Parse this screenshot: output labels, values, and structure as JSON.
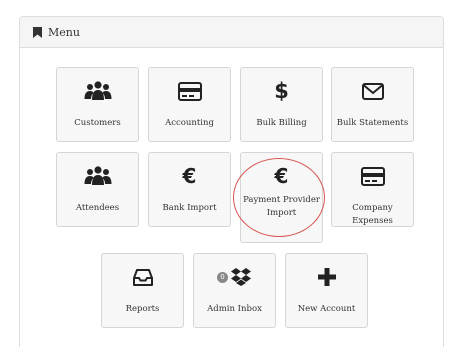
{
  "panel": {
    "title": "Menu",
    "icon": "bookmark-icon"
  },
  "tiles": [
    {
      "label": "Customers",
      "icon": "users-icon"
    },
    {
      "label": "Accounting",
      "icon": "credit-card-icon"
    },
    {
      "label": "Bulk Billing",
      "icon": "dollar-icon",
      "glyph": "$"
    },
    {
      "label": "Bulk Statements",
      "icon": "envelope-icon"
    },
    {
      "label": "Attendees",
      "icon": "users-icon"
    },
    {
      "label": "Bank Import",
      "icon": "euro-icon",
      "glyph": "€"
    },
    {
      "label": "Payment Provider Import",
      "icon": "euro-icon",
      "glyph": "€"
    },
    {
      "label": "Company Expenses",
      "icon": "credit-card-icon"
    },
    {
      "label": "Reports",
      "icon": "inbox-icon"
    },
    {
      "label": "Admin Inbox",
      "icon": "dropbox-icon",
      "badge": "0"
    },
    {
      "label": "New Account",
      "icon": "plus-icon"
    }
  ],
  "highlight_color": "#d9534f"
}
